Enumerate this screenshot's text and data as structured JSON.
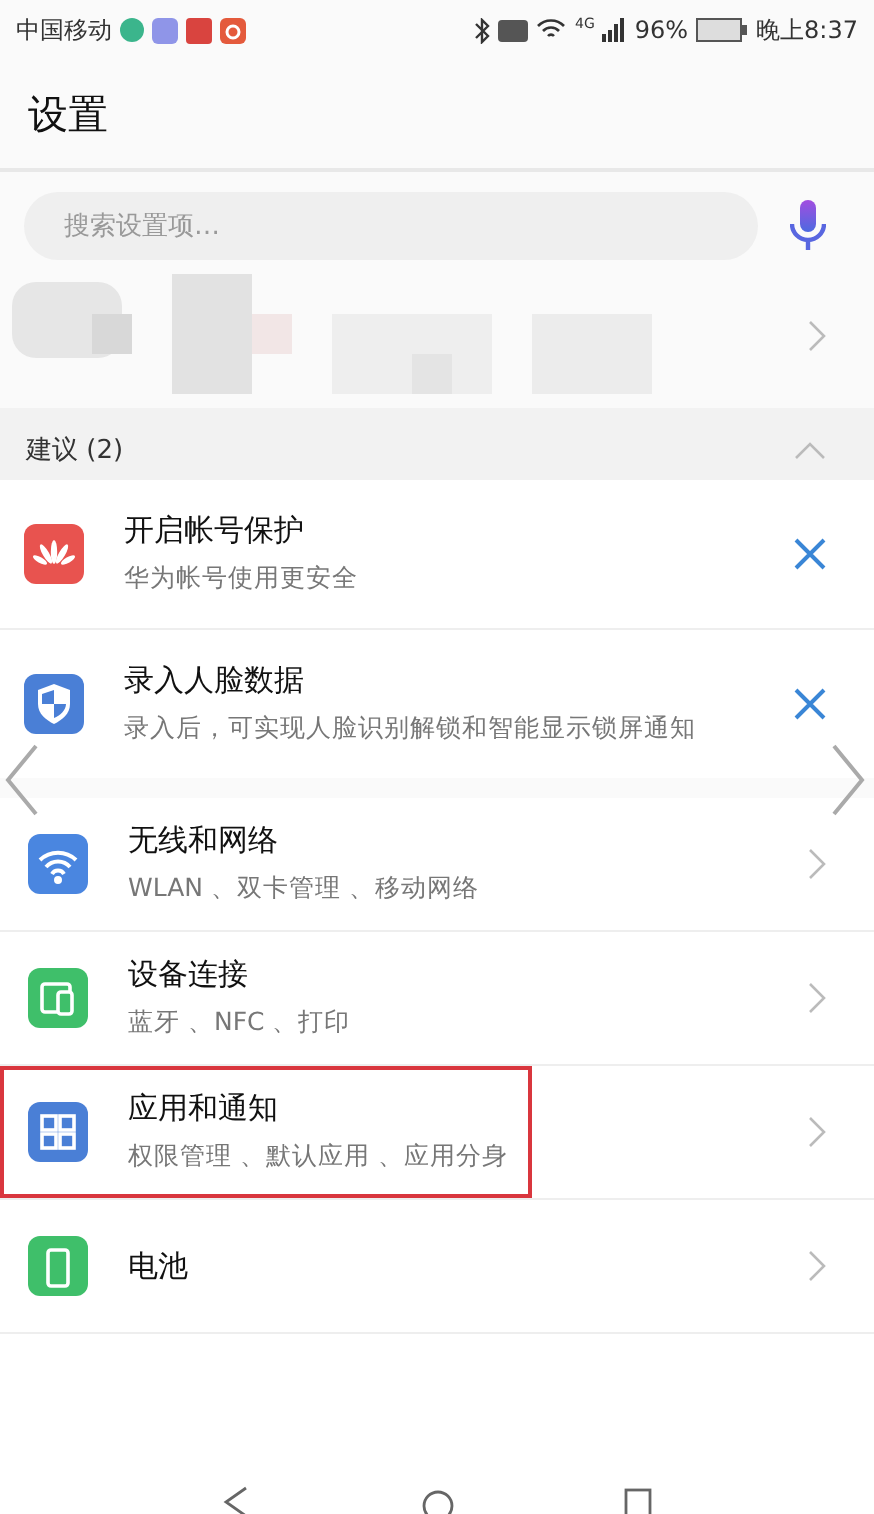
{
  "status_bar": {
    "carrier": "中国移动",
    "network": "4G",
    "battery": "96%",
    "time": "晚上8:37"
  },
  "header": {
    "title": "设置"
  },
  "search": {
    "placeholder": "搜索设置项…"
  },
  "suggestions": {
    "title": "建议 (2)",
    "expanded": true,
    "items": [
      {
        "kind": "huawei",
        "title": "开启帐号保护",
        "subtitle": "华为帐号使用更安全"
      },
      {
        "kind": "shield",
        "title": "录入人脸数据",
        "subtitle": "录入后，可实现人脸识别解锁和智能显示锁屏通知"
      }
    ]
  },
  "settings": [
    {
      "kind": "wifi",
      "title": "无线和网络",
      "subtitle": "WLAN 、双卡管理 、移动网络",
      "highlighted": false
    },
    {
      "kind": "devices",
      "title": "设备连接",
      "subtitle": "蓝牙 、NFC 、打印",
      "highlighted": false
    },
    {
      "kind": "apps",
      "title": "应用和通知",
      "subtitle": "权限管理 、默认应用 、应用分身",
      "highlighted": true
    },
    {
      "kind": "battery",
      "title": "电池",
      "highlighted": false
    }
  ]
}
